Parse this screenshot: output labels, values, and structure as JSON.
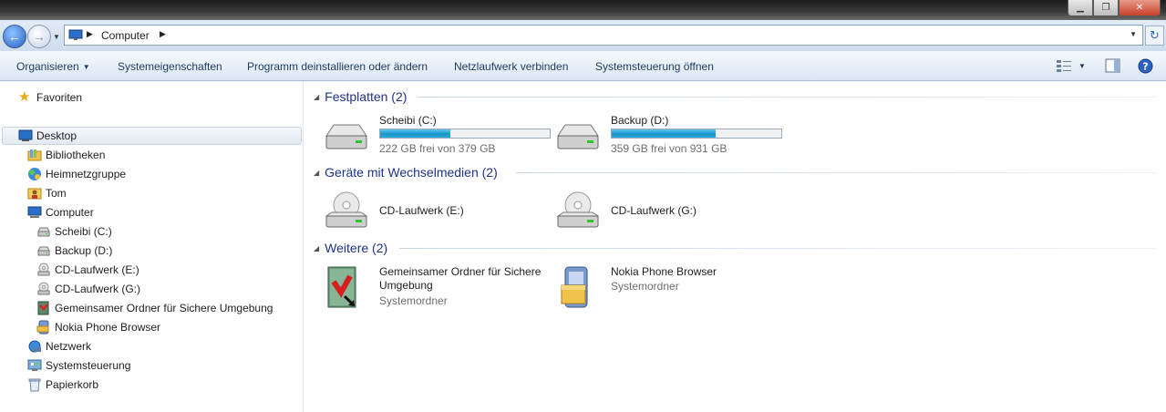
{
  "address": {
    "crumb": "Computer"
  },
  "toolbar": {
    "organize": "Organisieren",
    "system_properties": "Systemeigenschaften",
    "uninstall": "Programm deinstallieren oder ändern",
    "map_drive": "Netzlaufwerk verbinden",
    "control_panel": "Systemsteuerung öffnen"
  },
  "nav": {
    "favorites": "Favoriten",
    "desktop": "Desktop",
    "libraries": "Bibliotheken",
    "homegroup": "Heimnetzgruppe",
    "user": "Tom",
    "computer": "Computer",
    "drive_c": "Scheibi (C:)",
    "drive_d": "Backup (D:)",
    "drive_e": "CD-Laufwerk (E:)",
    "drive_g": "CD-Laufwerk (G:)",
    "shared_folder": "Gemeinsamer Ordner für Sichere Umgebung",
    "nokia": "Nokia Phone Browser",
    "network": "Netzwerk",
    "control_panel": "Systemsteuerung",
    "recycle_bin": "Papierkorb"
  },
  "groups": {
    "hard_disks": "Festplatten (2)",
    "removable": "Geräte mit Wechselmedien (2)",
    "other": "Weitere (2)"
  },
  "hard_disks": [
    {
      "name": "Scheibi (C:)",
      "free": "222 GB frei von 379 GB",
      "used_fraction": 0.414
    },
    {
      "name": "Backup (D:)",
      "free": "359 GB frei von 931 GB",
      "used_fraction": 0.614
    }
  ],
  "removable": [
    {
      "name": "CD-Laufwerk (E:)"
    },
    {
      "name": "CD-Laufwerk (G:)"
    }
  ],
  "other": [
    {
      "name": "Gemeinsamer Ordner für Sichere Umgebung",
      "type": "Systemordner"
    },
    {
      "name": "Nokia Phone Browser",
      "type": "Systemordner"
    }
  ],
  "colors": {
    "accent": "#1e3287",
    "bar_fill": "#1a94c9"
  }
}
